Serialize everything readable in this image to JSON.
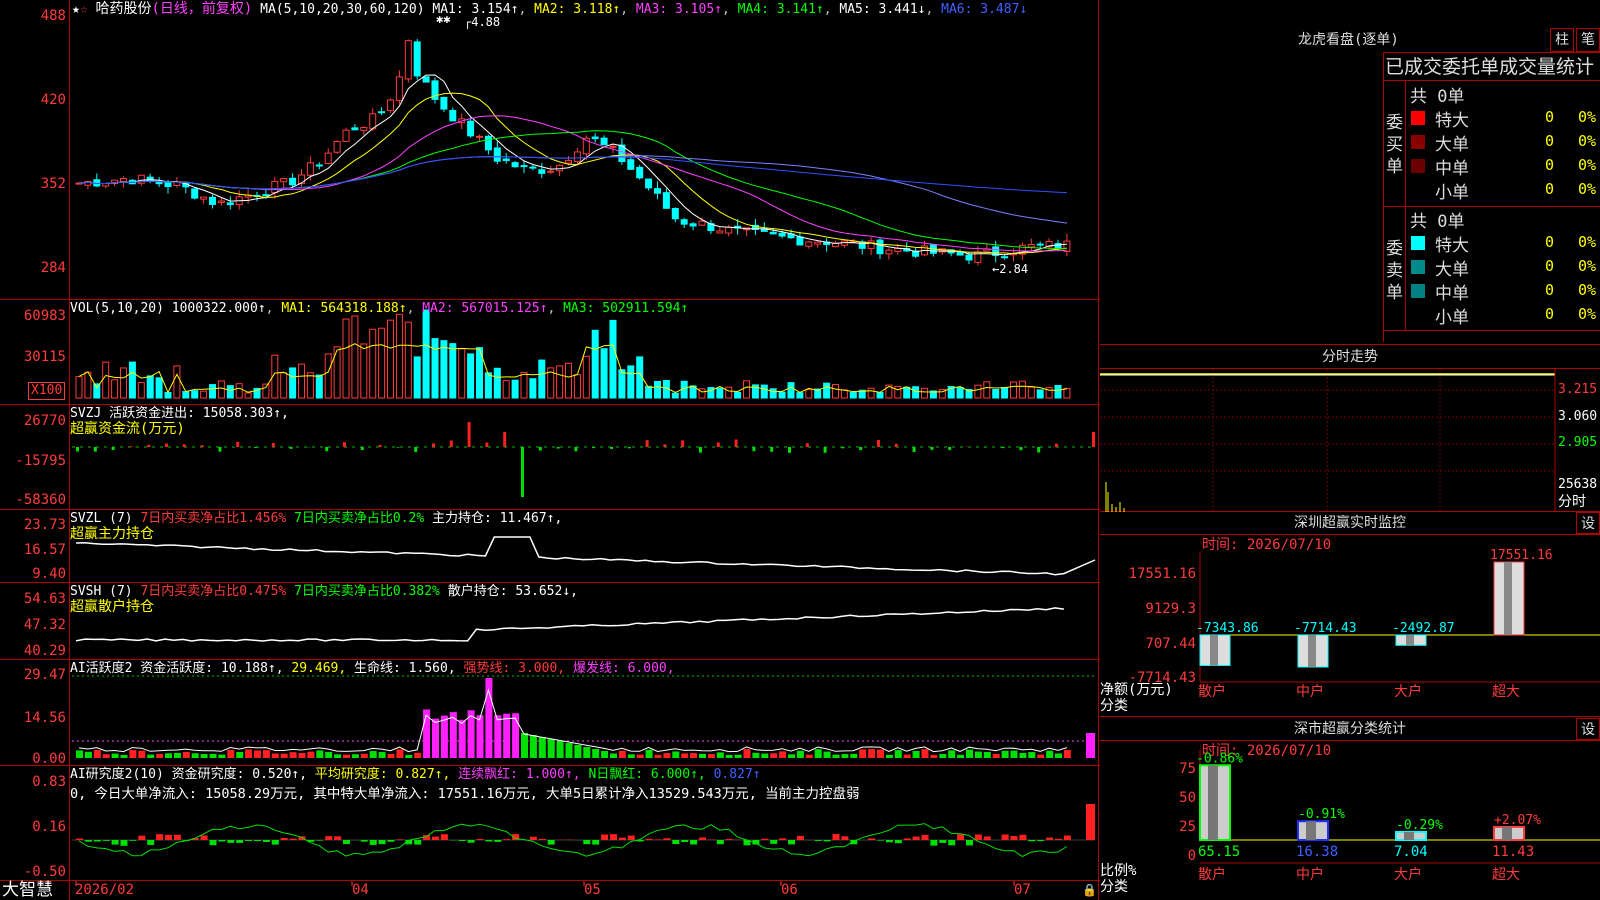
{
  "main": {
    "stock_name": "哈药股份",
    "mode": "(日线，前复权)",
    "ma_label": "MA(5,10,20,30,60,120)",
    "ma1": "MA1: 3.154↑",
    "ma2": "MA2: 3.118↑",
    "ma3": "MA3: 3.105↑",
    "ma4": "MA4: 3.141↑",
    "ma5": "MA5: 3.441↓",
    "ma6": "MA6: 3.487↓",
    "high_note": "4.88",
    "low_note": "←2.84",
    "ticks": [
      "488",
      "420",
      "352",
      "284"
    ]
  },
  "vol": {
    "label": "VOL(5,10,20) 1000322.000↑",
    "ma1": "MA1: 564318.188↑",
    "ma2": "MA2: 567015.125↑",
    "ma3": "MA3: 502911.594↑",
    "ticks": [
      "60983",
      "30115"
    ],
    "unit": "X100"
  },
  "svzj": {
    "label": "SVZJ  活跃资金进出: 15058.303↑,",
    "title": "超赢资金流(万元)",
    "ticks": [
      "26770",
      "-15795",
      "-58360"
    ]
  },
  "svzl": {
    "label": "SVZL (7)",
    "p1": "7日内买卖净占比1.456%",
    "p2": "7日内买卖净占比0.2%",
    "p3": "主力持仓: 11.467↑,",
    "title": "超赢主力持仓",
    "ticks": [
      "23.73",
      "16.57",
      "9.40"
    ]
  },
  "svsh": {
    "label": "SVSH (7)",
    "p1": "7日内买卖净占比0.475%",
    "p2": "7日内买卖净占比0.382%",
    "p3": "散户持仓: 53.652↓,",
    "title": "超赢散户持仓",
    "ticks": [
      "54.63",
      "47.32",
      "40.29"
    ]
  },
  "ai1": {
    "label": "AI活跃度2 资金活跃度: 10.188↑,",
    "v2": "29.469,",
    "v3": "生命线: 1.560,",
    "v4": "强势线: 3.000,",
    "v5": "爆发线: 6.000,",
    "ticks": [
      "29.47",
      "14.56",
      "0.00"
    ]
  },
  "ai2": {
    "label": "AI研究度2(10) 资金研究度: 0.520↑,",
    "v2": "平均研究度: 0.827↑,",
    "v3": "连续飘红: 1.000↑,",
    "v4": "N日飘红: 6.000↑,",
    "v5": "0.827↑",
    "summary": "0, 今日大单净流入: 15058.29万元, 其中特大单净流入: 17551.16万元, 大单5日累计净入13529.543万元, 当前主力控盘弱",
    "ticks": [
      "0.83",
      "0.16",
      "-0.50"
    ]
  },
  "xaxis": {
    "brand": "大智慧",
    "labels": [
      "2026/02",
      "04",
      "05",
      "06",
      "07"
    ]
  },
  "dragon": {
    "title": "龙虎看盘(逐单)",
    "btn1": "柱",
    "btn2": "笔",
    "stat_title": "已成交委托单成交量统计",
    "buy_label": "委买单",
    "sell_label": "委卖单",
    "buy_total": "共 0单",
    "sell_total": "共 0单",
    "buy_rows": [
      {
        "name": "特大",
        "count": "0",
        "pct": "0%",
        "color": "#ff0000"
      },
      {
        "name": "大单",
        "count": "0",
        "pct": "0%",
        "color": "#8a0000"
      },
      {
        "name": "中单",
        "count": "0",
        "pct": "0%",
        "color": "#6a0000"
      },
      {
        "name": "小单",
        "count": "0",
        "pct": "0%",
        "color": ""
      }
    ],
    "sell_rows": [
      {
        "name": "特大",
        "count": "0",
        "pct": "0%",
        "color": "#00ffff"
      },
      {
        "name": "大单",
        "count": "0",
        "pct": "0%",
        "color": "#008a8a"
      },
      {
        "name": "中单",
        "count": "0",
        "pct": "0%",
        "color": "#008080"
      },
      {
        "name": "小单",
        "count": "0",
        "pct": "0%",
        "color": ""
      }
    ]
  },
  "minute": {
    "title": "分时走势",
    "ticks": [
      "3.215",
      "3.060",
      "2.905"
    ],
    "vol_tick": "25638",
    "vol_unit": "分时"
  },
  "monitor": {
    "title": "深圳超赢实时监控",
    "settings": "设",
    "time": "时间: 2026/07/10",
    "ticks": [
      "17551.16",
      "9129.3",
      "707.44",
      "-7714.43"
    ],
    "y_label": "净额(万元)",
    "x_label": "分类",
    "chart_data": {
      "type": "bar",
      "categories": [
        "散户",
        "中户",
        "大户",
        "超大"
      ],
      "values": [
        -7343.86,
        -7714.43,
        -2492.87,
        17551.16
      ],
      "value_labels": [
        "-7343.86",
        "-7714.43",
        "-2492.87",
        "17551.16"
      ],
      "ylim": [
        -7714.43,
        17551.16
      ]
    }
  },
  "classify": {
    "title": "深市超赢分类统计",
    "settings": "设",
    "time": "时间: 2026/07/10",
    "ticks": [
      "75",
      "50",
      "25",
      "0"
    ],
    "y_label": "比例%",
    "x_label": "分类",
    "chart_data": {
      "type": "bar",
      "categories": [
        "散户",
        "中户",
        "大户",
        "超大"
      ],
      "values": [
        65.15,
        16.38,
        7.04,
        11.43
      ],
      "value_labels": [
        "65.15",
        "16.38",
        "7.04",
        "11.43"
      ],
      "changes": [
        "-0.86%",
        "-0.91%",
        "-0.29%",
        "+2.07%"
      ],
      "ylim": [
        0,
        75
      ]
    }
  }
}
